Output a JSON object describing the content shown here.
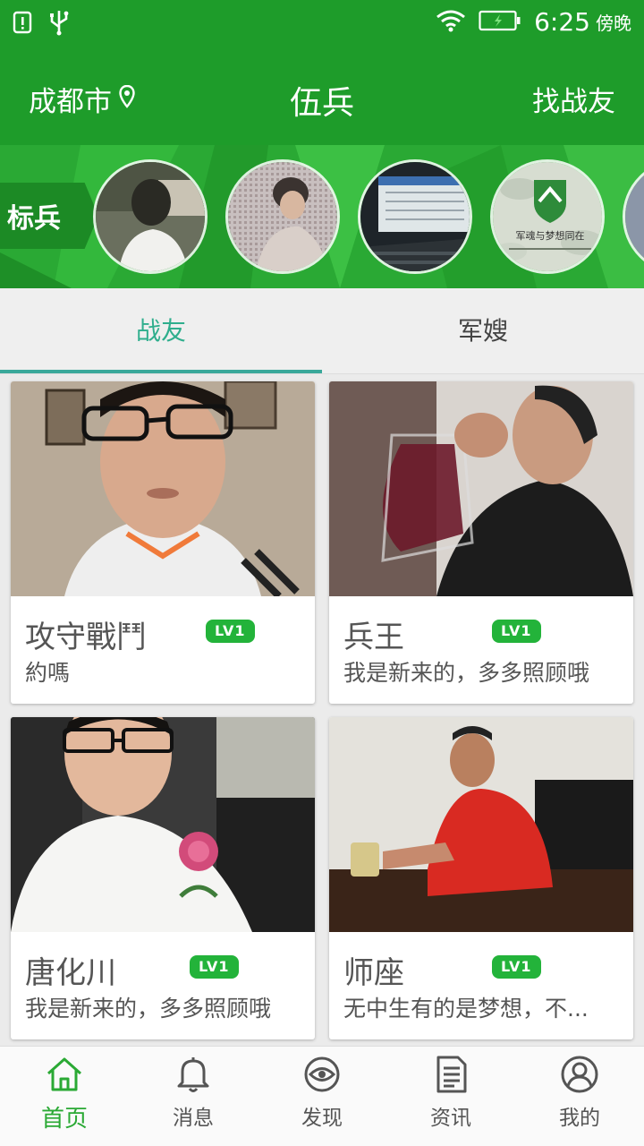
{
  "status_bar": {
    "time": "6:25",
    "period": "傍晚",
    "icons": [
      "alert-icon",
      "usb-icon",
      "wifi-icon",
      "battery-icon"
    ]
  },
  "header": {
    "city": "成都市",
    "title": "伍兵",
    "find_button": "找战友"
  },
  "banner": {
    "tag": "标兵",
    "logo_text": "军魂与梦想同在"
  },
  "tabs": [
    {
      "label": "战友",
      "active": true
    },
    {
      "label": "军嫂",
      "active": false
    }
  ],
  "cards": [
    {
      "name": "攻守戰鬥",
      "level": "LV1",
      "bio": "約嗎"
    },
    {
      "name": "兵王",
      "level": "LV1",
      "bio": "我是新来的，多多照顾哦"
    },
    {
      "name": "唐化川",
      "level": "LV1",
      "bio": "我是新来的，多多照顾哦"
    },
    {
      "name": "师座",
      "level": "LV1",
      "bio": "无中生有的是梦想，不..."
    }
  ],
  "bottom_nav": [
    {
      "label": "首页",
      "icon": "home-icon",
      "active": true
    },
    {
      "label": "消息",
      "icon": "bell-icon",
      "active": false
    },
    {
      "label": "发现",
      "icon": "eye-icon",
      "active": false
    },
    {
      "label": "资讯",
      "icon": "document-icon",
      "active": false
    },
    {
      "label": "我的",
      "icon": "user-icon",
      "active": false
    }
  ],
  "colors": {
    "brand_green": "#1e9c2a",
    "tab_active": "#2fae8d",
    "level_badge": "#23b33a"
  }
}
